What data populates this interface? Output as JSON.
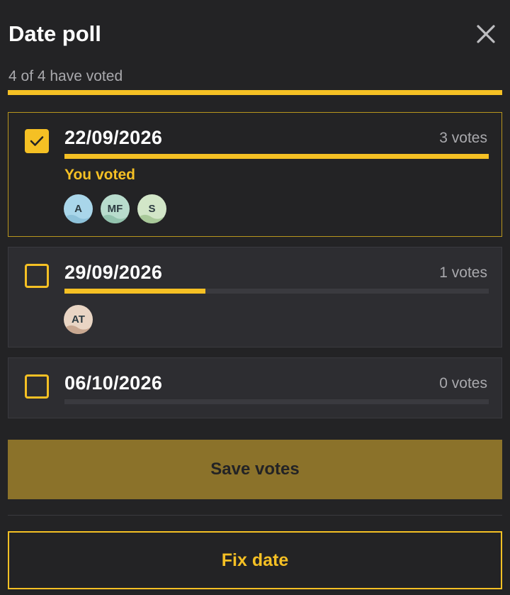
{
  "header": {
    "title": "Date poll",
    "close_icon": "close-icon"
  },
  "summary": {
    "text": "4 of 4 have voted",
    "voted": 4,
    "total": 4,
    "progress": 1.0
  },
  "colors": {
    "accent": "#f5c024",
    "background": "#232325",
    "card": "#2d2d31",
    "save_button": "#8b722a"
  },
  "options": [
    {
      "date": "22/09/2026",
      "votes_label": "3 votes",
      "votes": 3,
      "progress": 1.0,
      "checked": true,
      "you_voted": "You voted",
      "voters": [
        {
          "initials": "A",
          "bg": "#a9d6ea",
          "hill": "#8ec2da"
        },
        {
          "initials": "MF",
          "bg": "#b8dccd",
          "hill": "#93c3ae"
        },
        {
          "initials": "S",
          "bg": "#d2e6c8",
          "hill": "#a9c99a"
        }
      ]
    },
    {
      "date": "29/09/2026",
      "votes_label": "1 votes",
      "votes": 1,
      "progress": 0.333,
      "checked": false,
      "voters": [
        {
          "initials": "AT",
          "bg": "#e9d5c4",
          "hill": "#c9a891"
        }
      ]
    },
    {
      "date": "06/10/2026",
      "votes_label": "0 votes",
      "votes": 0,
      "progress": 0,
      "checked": false,
      "voters": []
    }
  ],
  "actions": {
    "save_label": "Save votes",
    "fix_label": "Fix date"
  }
}
